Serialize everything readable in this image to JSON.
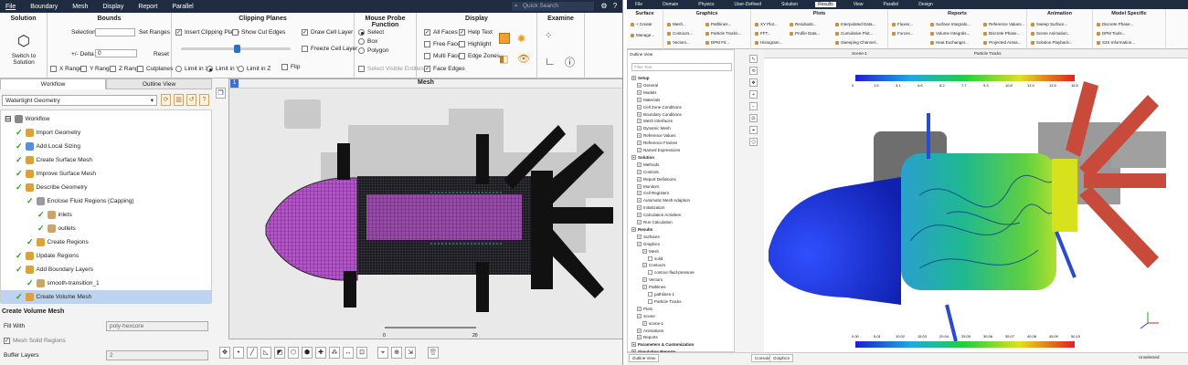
{
  "left_app": {
    "menu": [
      "File",
      "Boundary",
      "Mesh",
      "Display",
      "Report",
      "Parallel"
    ],
    "quick_search_placeholder": "Quick Search",
    "ribbon": {
      "solution": {
        "title": "Solution",
        "switch_label_1": "Switch to",
        "switch_label_2": "Solution"
      },
      "bounds": {
        "title": "Bounds",
        "selection_label": "Selection",
        "set_ranges": "Set Ranges",
        "delta_label": "+/- Delta",
        "delta_value": "0",
        "reset": "Reset",
        "x_range": "X Range",
        "y_range": "Y Range",
        "z_range": "Z Range",
        "cutplanes": "Cutplanes"
      },
      "clipping": {
        "title": "Clipping Planes",
        "insert": "Insert Clipping Plane",
        "show_cut_edges": "Show Cut Edges",
        "draw_cell_layer": "Draw Cell Layer",
        "freeze_cell_layer": "Freeze Cell Layer",
        "limit_x": "Limit in X",
        "limit_y": "Limit in Y",
        "limit_z": "Limit in Z",
        "flip": "Flip"
      },
      "probe": {
        "title": "Mouse Probe Function",
        "select": "Select",
        "box": "Box",
        "polygon": "Polygon",
        "visible": "Select Visible Entities"
      },
      "display": {
        "title": "Display",
        "all_faces": "All Faces",
        "help_text": "Help Text",
        "free_faces": "Free Faces",
        "highlight": "Highlight",
        "multi_faces": "Multi Faces",
        "edge_zones": "Edge Zones",
        "face_edges": "Face Edges"
      },
      "examine": {
        "title": "Examine"
      }
    },
    "tabs": [
      "Workflow",
      "Outline View"
    ],
    "workflow_select": "Watertight Geometry",
    "tree": [
      {
        "label": "Workflow",
        "level": 0,
        "status": "none"
      },
      {
        "label": "Import Geometry",
        "level": 1,
        "status": "done"
      },
      {
        "label": "Add Local Sizing",
        "level": 1,
        "status": "done"
      },
      {
        "label": "Create Surface Mesh",
        "level": 1,
        "status": "done"
      },
      {
        "label": "Improve Surface Mesh",
        "level": 1,
        "status": "done"
      },
      {
        "label": "Describe Geometry",
        "level": 1,
        "status": "done"
      },
      {
        "label": "Enclose Fluid Regions (Capping)",
        "level": 2,
        "status": "done"
      },
      {
        "label": "inlets",
        "level": 3,
        "status": "done"
      },
      {
        "label": "outlets",
        "level": 3,
        "status": "done"
      },
      {
        "label": "Create Regions",
        "level": 2,
        "status": "done"
      },
      {
        "label": "Update Regions",
        "level": 1,
        "status": "done"
      },
      {
        "label": "Add Boundary Layers",
        "level": 1,
        "status": "done"
      },
      {
        "label": "smooth-transition_1",
        "level": 2,
        "status": "done"
      },
      {
        "label": "Create Volume Mesh",
        "level": 1,
        "status": "selected"
      }
    ],
    "volume_mesh": {
      "title": "Create Volume Mesh",
      "fill_with_label": "Fill With",
      "fill_with_value": "poly-hexcore",
      "mesh_solid_regions": "Mesh Solid Regions",
      "buffer_layers_label": "Buffer Layers",
      "buffer_layers_value": "2"
    },
    "viewport_title": "Mesh",
    "scale_labels": [
      "0",
      "20"
    ]
  },
  "right_app": {
    "menu": [
      "File",
      "Domain",
      "Physics",
      "User-Defined",
      "Solution",
      "Results",
      "View",
      "Parallel",
      "Design"
    ],
    "active_menu": "Results",
    "ribbon_groups": [
      "Surface",
      "Graphics",
      "Plots",
      "Reports",
      "Animation",
      "Model Specific"
    ],
    "ribbon_items": {
      "Surface": [
        "+ Create",
        "Manage..."
      ],
      "Graphics": [
        "Mesh...",
        "Contours...",
        "Vectors...",
        "Pathlines...",
        "Particle Tracks...",
        "DPM Fit..."
      ],
      "Plots": [
        "XY Plot...",
        "FFT...",
        "Histogram...",
        "Residuals...",
        "Profile Data...",
        "Interpolated Data...",
        "Cumulative Plot...",
        "Sweeping Channel..."
      ],
      "Reports": [
        "Fluxes...",
        "Forces...",
        "Surface Integrals...",
        "Volume Integrals...",
        "Heat Exchanger...",
        "Reference Values...",
        "Discrete Phase...",
        "Projected Areas..."
      ],
      "Animation": [
        "Sweep Surface...",
        "Scene Animation...",
        "Solution Playback..."
      ],
      "Model Specific": [
        "Discrete Phase...",
        "DPM Tools...",
        "S2S Information..."
      ]
    },
    "tree_title": "Outline View",
    "filter_placeholder": "Filter Text",
    "tree": [
      {
        "label": "Setup",
        "level": 0
      },
      {
        "label": "General",
        "level": 1
      },
      {
        "label": "Models",
        "level": 1
      },
      {
        "label": "Materials",
        "level": 1
      },
      {
        "label": "Cell Zone Conditions",
        "level": 1
      },
      {
        "label": "Boundary Conditions",
        "level": 1
      },
      {
        "label": "Mesh Interfaces",
        "level": 1
      },
      {
        "label": "Dynamic Mesh",
        "level": 1
      },
      {
        "label": "Reference Values",
        "level": 1
      },
      {
        "label": "Reference Frames",
        "level": 1
      },
      {
        "label": "Named Expressions",
        "level": 1
      },
      {
        "label": "Solution",
        "level": 0
      },
      {
        "label": "Methods",
        "level": 1
      },
      {
        "label": "Controls",
        "level": 1
      },
      {
        "label": "Report Definitions",
        "level": 1
      },
      {
        "label": "Monitors",
        "level": 1
      },
      {
        "label": "Cell Registers",
        "level": 1
      },
      {
        "label": "Automatic Mesh Adaption",
        "level": 1
      },
      {
        "label": "Initialization",
        "level": 1
      },
      {
        "label": "Calculation Activities",
        "level": 1
      },
      {
        "label": "Run Calculation",
        "level": 1
      },
      {
        "label": "Results",
        "level": 0
      },
      {
        "label": "Surfaces",
        "level": 1
      },
      {
        "label": "Graphics",
        "level": 1
      },
      {
        "label": "Mesh",
        "level": 2
      },
      {
        "label": "solid",
        "level": 3
      },
      {
        "label": "Contours",
        "level": 2
      },
      {
        "label": "contour-fluid-pressure",
        "level": 3
      },
      {
        "label": "Vectors",
        "level": 2
      },
      {
        "label": "Pathlines",
        "level": 2
      },
      {
        "label": "pathlines-1",
        "level": 3
      },
      {
        "label": "Particle Tracks",
        "level": 3
      },
      {
        "label": "Plots",
        "level": 1
      },
      {
        "label": "Scene",
        "level": 1
      },
      {
        "label": "scene-1",
        "level": 2
      },
      {
        "label": "Animations",
        "level": 1
      },
      {
        "label": "Reports",
        "level": 1
      },
      {
        "label": "Parameters & Customization",
        "level": 0
      },
      {
        "label": "Simulation Reports",
        "level": 0
      }
    ],
    "viewport_tabs": [
      "Console",
      "Graphics"
    ],
    "window_tabs": [
      "Scene-1",
      "Particle Tracks"
    ],
    "colorbar_top_ticks": [
      "0",
      "1.5",
      "3.1",
      "4.6",
      "6.2",
      "7.7",
      "9.3",
      "10.8",
      "12.4",
      "13.9",
      "15.5"
    ],
    "colorbar_bottom_ticks": [
      "0.00",
      "5.01",
      "10.02",
      "15.03",
      "20.04",
      "25.05",
      "30.06",
      "35.07",
      "40.08",
      "45.09",
      "50.10"
    ],
    "bottom_status": "Unselected",
    "colors": {
      "accent": "#1f2b40",
      "mesh_purple": "#b255c6",
      "brand_orange": "#f0a030"
    }
  }
}
